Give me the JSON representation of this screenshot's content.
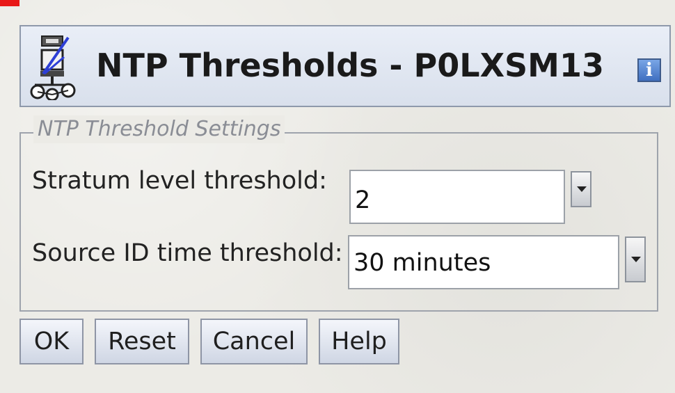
{
  "window": {
    "title": "NTP Thresholds - P0LXSM13",
    "app_icon": "ntp-node-icon",
    "info_icon": "info-icon",
    "info_glyph": "i"
  },
  "settings": {
    "legend": "NTP Threshold Settings",
    "stratum": {
      "label": "Stratum level threshold:",
      "value": "2"
    },
    "source_id": {
      "label": "Source ID time threshold:",
      "value": "30 minutes"
    }
  },
  "buttons": {
    "ok": "OK",
    "reset": "Reset",
    "cancel": "Cancel",
    "help": "Help"
  },
  "colors": {
    "accent_red": "#e81818",
    "title_bar_border": "#8e99ab",
    "info_blue": "#3f6fc0"
  }
}
